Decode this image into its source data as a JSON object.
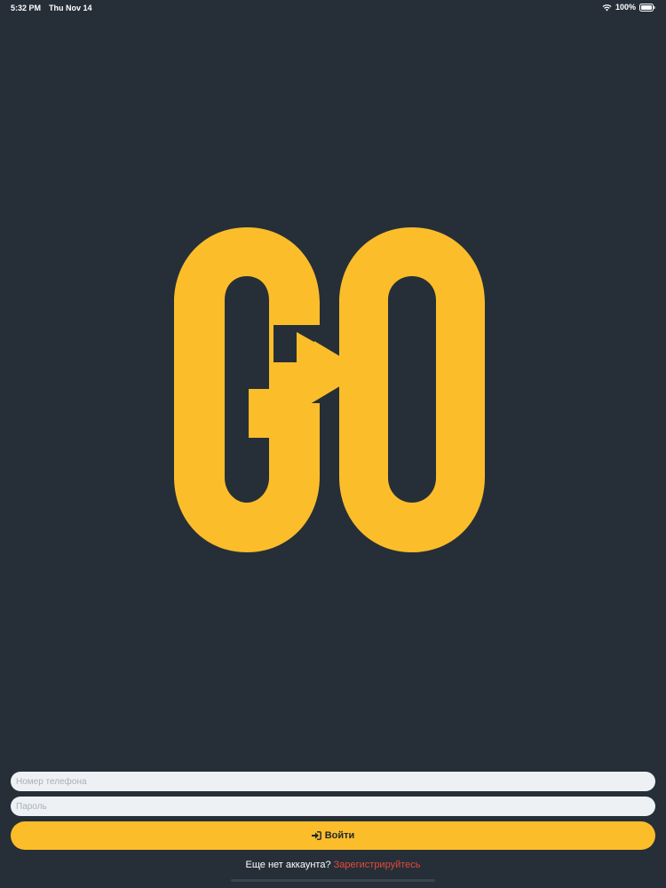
{
  "status_bar": {
    "time": "5:32 PM",
    "date": "Thu Nov 14",
    "battery": "100%"
  },
  "logo": {
    "text": "GO",
    "color": "#fbbd2a",
    "icon": "arrow-right-icon"
  },
  "form": {
    "phone_placeholder": "Номер телефона",
    "phone_value": "",
    "password_placeholder": "Пароль",
    "password_value": "",
    "login_label": "Войти",
    "login_icon": "sign-in-icon"
  },
  "signup": {
    "prompt": "Еще нет аккаунта?",
    "link": "Зарегистрируйтесь"
  },
  "colors": {
    "background": "#262f38",
    "accent": "#fbbd2a",
    "link": "#e8473c"
  }
}
